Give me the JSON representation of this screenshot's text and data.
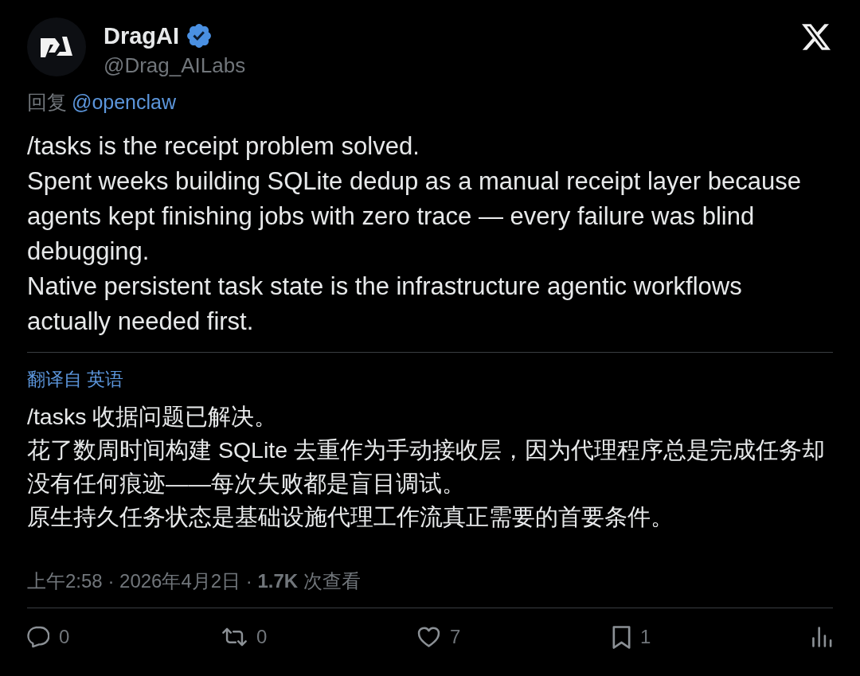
{
  "author": {
    "name": "DragAI",
    "verified": true,
    "handle": "@Drag_AILabs"
  },
  "reply_to": {
    "prefix": "回复",
    "mention": "@openclaw"
  },
  "body": [
    "/tasks is the receipt problem solved.",
    "Spent weeks building SQLite dedup as a manual receipt layer because agents kept finishing jobs with zero trace — every failure was blind debugging.",
    "Native persistent task state is the infrastructure agentic workflows actually needed first."
  ],
  "translation": {
    "label": "翻译自 英语",
    "paragraphs": [
      "/tasks 收据问题已解决。",
      "花了数周时间构建 SQLite 去重作为手动接收层，因为代理程序总是完成任务却没有任何痕迹——每次失败都是盲目调试。",
      "原生持久任务状态是基础设施代理工作流真正需要的首要条件。"
    ]
  },
  "meta": "上午2:58 · 2026年4月2日 · **1.7K** 次查看",
  "actions": [
    {
      "kind": "reply",
      "count": "0"
    },
    {
      "kind": "repost",
      "count": "0"
    },
    {
      "kind": "like",
      "count": "7"
    },
    {
      "kind": "bookmark",
      "count": "1"
    },
    {
      "kind": "analytics"
    }
  ]
}
